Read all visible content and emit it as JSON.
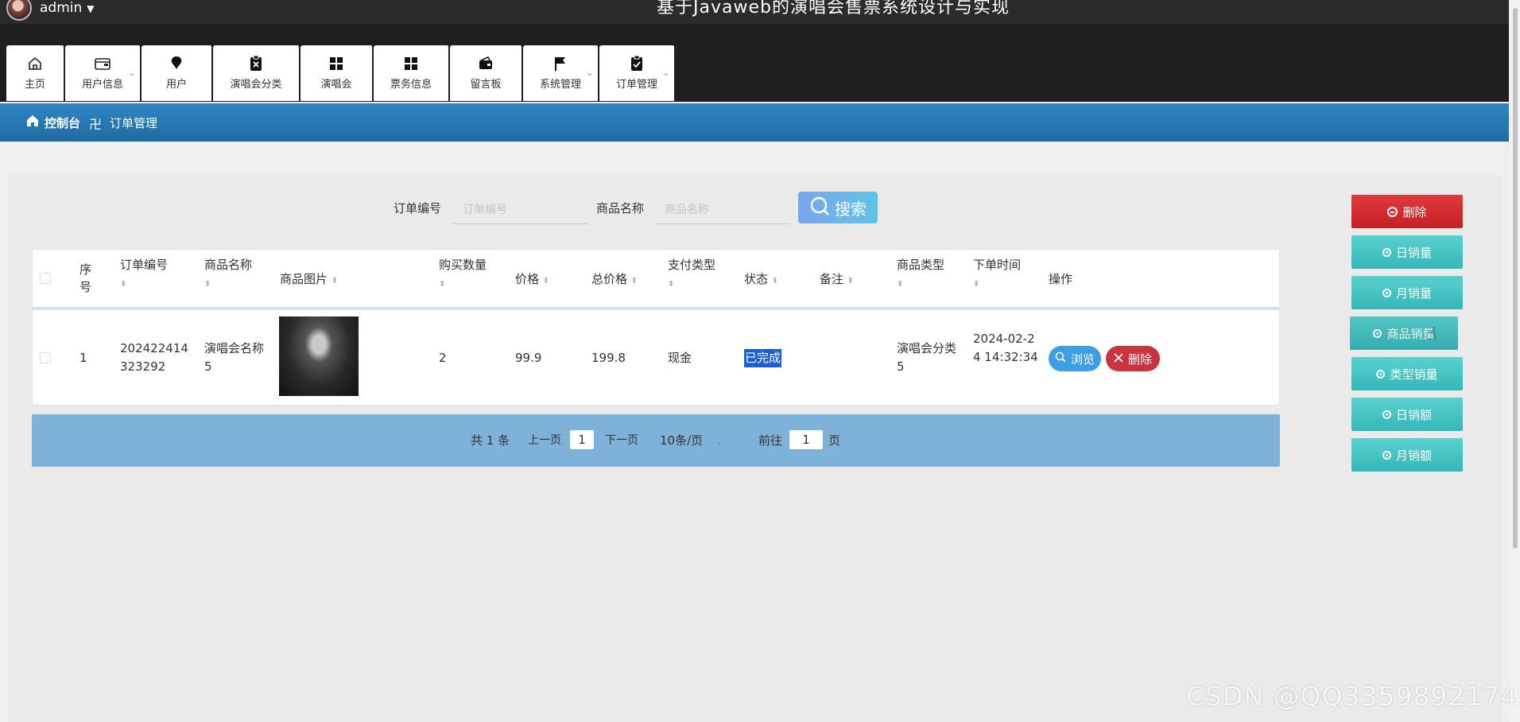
{
  "header": {
    "username": "admin",
    "system_title": "基于Javaweb的演唱会售票系统设计与实现"
  },
  "nav": {
    "items": [
      {
        "label": "主页",
        "icon": "home-icon"
      },
      {
        "label": "用户信息",
        "icon": "wallet-icon"
      },
      {
        "label": "用户",
        "icon": "pin-icon"
      },
      {
        "label": "演唱会分类",
        "icon": "clipboard-x-icon"
      },
      {
        "label": "演唱会",
        "icon": "grid-icon"
      },
      {
        "label": "票务信息",
        "icon": "grid-icon"
      },
      {
        "label": "留言板",
        "icon": "wallet-icon"
      },
      {
        "label": "系统管理",
        "icon": "flag-icon"
      },
      {
        "label": "订单管理",
        "icon": "clipboard-check-icon"
      }
    ]
  },
  "breadcrumb": {
    "home": "控制台",
    "separator": "卍",
    "current": "订单管理"
  },
  "search": {
    "order_no_label": "订单编号",
    "order_no_placeholder": "订单编号",
    "product_label": "商品名称",
    "product_placeholder": "商品名称",
    "button": "搜索"
  },
  "table": {
    "headers": {
      "index": "序号",
      "order_no": "订单编号",
      "product_name": "商品名称",
      "product_image": "商品图片",
      "quantity": "购买数量",
      "price": "价格",
      "total": "总价格",
      "pay_type": "支付类型",
      "status": "状态",
      "remark": "备注",
      "product_type": "商品类型",
      "order_time": "下单时间",
      "actions": "操作"
    },
    "rows": [
      {
        "index": "1",
        "order_no": "202422414323292",
        "product_name": "演唱会名称5",
        "quantity": "2",
        "price": "99.9",
        "total": "199.8",
        "pay_type": "现金",
        "status": "已完成",
        "remark": "",
        "product_type": "演唱会分类5",
        "order_time": "2024-02-24 14:32:34",
        "view_label": "浏览",
        "delete_label": "删除"
      }
    ]
  },
  "pager": {
    "total": "共 1 条",
    "prev": "上一页",
    "page": "1",
    "next": "下一页",
    "page_size": "10条/页",
    "goto": "前往",
    "goto_value": "1",
    "page_unit": "页"
  },
  "side_buttons": {
    "delete": "删除",
    "daily_sales": "日销量",
    "monthly_sales": "月销量",
    "product_sales": "商品销量",
    "type_sales": "类型销量",
    "daily_amount": "日销额",
    "monthly_amount": "月销额"
  },
  "watermark": "CSDN @QQ3359892174",
  "colors": {
    "topbar": "#1f1f1f",
    "breadcrumb": "#2f86c2",
    "danger": "#c71f27",
    "teal": "#35b6b8",
    "pager": "#7fb2d8"
  }
}
